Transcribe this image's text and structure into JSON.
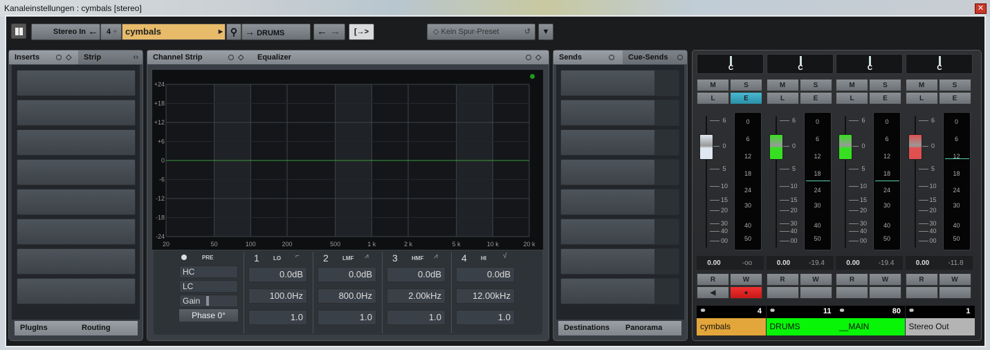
{
  "window": {
    "title": "Kanaleinstellungen : cymbals [stereo]",
    "close": "✕"
  },
  "toolbar": {
    "input": "Stereo In",
    "channel_number": "4",
    "channel_name": "cymbals",
    "output": "DRUMS",
    "preset": "Kein Spur-Preset",
    "accent": "#e3b25a"
  },
  "inserts": {
    "tab1": "Inserts",
    "tab2": "Strip",
    "slots": 8,
    "bottom_tabs": [
      "PlugIns",
      "Routing"
    ]
  },
  "eq_panel": {
    "tab1": "Channel Strip",
    "tab2": "Equalizer",
    "pre": {
      "label": "PRE",
      "hc": "HC",
      "lc": "LC",
      "gain": "Gain",
      "phase": "Phase 0°"
    },
    "bands": [
      {
        "num": "1",
        "name": "LO",
        "gain": "0.0dB",
        "freq": "100.0Hz",
        "q": "1.0"
      },
      {
        "num": "2",
        "name": "LMF",
        "gain": "0.0dB",
        "freq": "800.0Hz",
        "q": "1.0"
      },
      {
        "num": "3",
        "name": "HMF",
        "gain": "0.0dB",
        "freq": "2.00kHz",
        "q": "1.0"
      },
      {
        "num": "4",
        "name": "HI",
        "gain": "0.0dB",
        "freq": "12.00kHz",
        "q": "1.0"
      }
    ]
  },
  "chart_data": {
    "type": "line",
    "xscale": "log",
    "xlim": [
      20,
      20000
    ],
    "ylim": [
      -24,
      24
    ],
    "grid": true,
    "x_ticks": [
      20,
      50,
      100,
      200,
      500,
      1000,
      2000,
      5000,
      10000,
      20000
    ],
    "x_tick_labels": [
      "20",
      "50",
      "100",
      "200",
      "500",
      "1 k",
      "2 k",
      "5 k",
      "10 k",
      "20 k"
    ],
    "y_ticks": [
      24,
      18,
      12,
      6,
      0,
      -6,
      -12,
      -18,
      -24
    ],
    "y_tick_labels": [
      "+24",
      "+18",
      "+12",
      "+6",
      "0",
      "-6",
      "-12",
      "-18",
      "-24"
    ],
    "series": [
      {
        "x": [
          20,
          20000
        ],
        "y": [
          0,
          0
        ],
        "color": "#3d9a3d"
      }
    ]
  },
  "sends": {
    "tab1": "Sends",
    "tab2": "Cue-Sends",
    "slots": 8,
    "bottom_tabs": [
      "Destinations",
      "Panorama"
    ]
  },
  "mixer": {
    "fader_scale": [
      "6",
      "0",
      "5",
      "10",
      "15",
      "20",
      "30",
      "40",
      "00"
    ],
    "meter_scale": [
      "0",
      "6",
      "12",
      "18",
      "24",
      "30",
      "40",
      "50"
    ],
    "buttons": {
      "m": "M",
      "s": "S",
      "l": "L",
      "e": "E",
      "r": "R",
      "w": "W"
    },
    "channels": [
      {
        "pan": "C",
        "volume": "0.00",
        "peak": "-oo",
        "number": "4",
        "name": "cymbals",
        "color": "#e3a63a",
        "fader_color": "#dfe8f2",
        "peak_db": null,
        "edit_active": true,
        "record": true
      },
      {
        "pan": "C",
        "volume": "0.00",
        "peak": "-19.4",
        "number": "11",
        "name": "DRUMS",
        "color": "#08f508",
        "fader_color": "#36e020",
        "peak_db": -19.4
      },
      {
        "pan": "C",
        "volume": "0.00",
        "peak": "-19.4",
        "number": "80",
        "name": "__MAIN",
        "color": "#08f508",
        "fader_color": "#36e020",
        "peak_db": -19.4
      },
      {
        "pan": "C",
        "volume": "0.00",
        "peak": "-11.8",
        "number": "1",
        "name": "Stereo Out",
        "color": "#b4b4b4",
        "fader_color": "#e05050",
        "peak_db": -11.8
      }
    ]
  }
}
